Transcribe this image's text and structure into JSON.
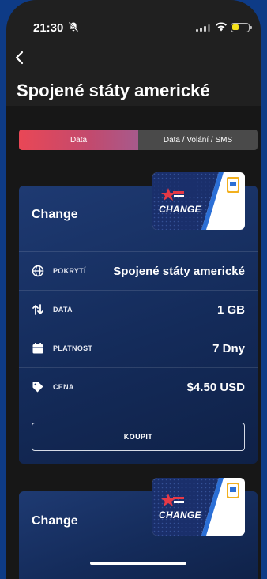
{
  "status_bar": {
    "time": "21:30",
    "mute_icon": "bell-slash-icon",
    "signal_icon": "cellular-signal-icon",
    "wifi_icon": "wifi-icon",
    "battery_icon": "battery-low-icon",
    "battery_color": "#f5e11b"
  },
  "header": {
    "back_icon": "chevron-left-icon",
    "title": "Spojené státy americké"
  },
  "tabs": [
    {
      "label": "Data",
      "active": true
    },
    {
      "label": "Data / Volání / SMS",
      "active": false
    }
  ],
  "colors": {
    "accent_start": "#e94756",
    "accent_end": "#a75a8c",
    "card_bg": "#1e3a72",
    "page_bg": "#171717"
  },
  "plans": [
    {
      "name": "Change",
      "logo_text": "CHANGE",
      "rows": [
        {
          "icon": "globe-icon",
          "label": "POKRYTÍ",
          "value": "Spojené státy americké"
        },
        {
          "icon": "arrows-up-down-icon",
          "label": "DATA",
          "value": "1 GB"
        },
        {
          "icon": "calendar-icon",
          "label": "PLATNOST",
          "value": "7 Dny"
        },
        {
          "icon": "price-tag-icon",
          "label": "CENA",
          "value": "$4.50 USD"
        }
      ],
      "button_label": "KOUPIT"
    },
    {
      "name": "Change",
      "logo_text": "CHANGE"
    }
  ]
}
